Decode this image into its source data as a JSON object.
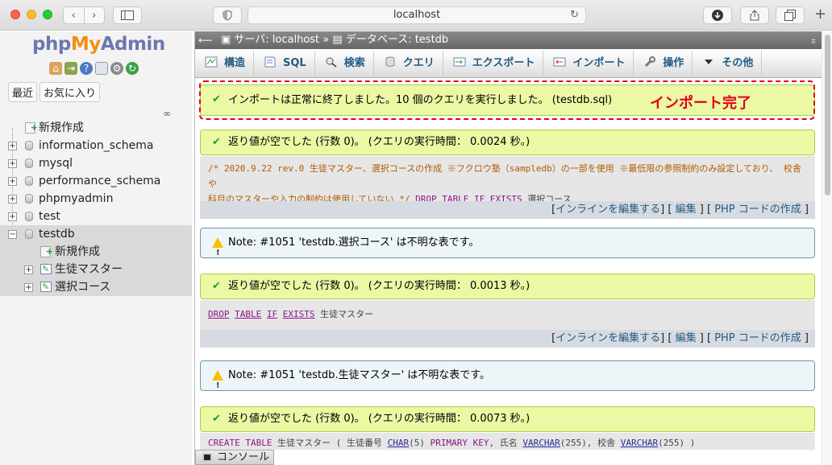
{
  "browser": {
    "url": "localhost"
  },
  "nav": {
    "logo": {
      "php": "php",
      "my": "My",
      "admin": "Admin"
    },
    "tabs": [
      "最近",
      "お気に入り"
    ],
    "tree": [
      {
        "label": "新規作成",
        "kind": "new"
      },
      {
        "label": "information_schema",
        "kind": "db"
      },
      {
        "label": "mysql",
        "kind": "db"
      },
      {
        "label": "performance_schema",
        "kind": "db"
      },
      {
        "label": "phpmyadmin",
        "kind": "db"
      },
      {
        "label": "test",
        "kind": "db"
      },
      {
        "label": "testdb",
        "kind": "db",
        "expanded": true
      },
      {
        "label": "新規作成",
        "kind": "new-sub"
      },
      {
        "label": "生徒マスター",
        "kind": "table"
      },
      {
        "label": "選択コース",
        "kind": "table"
      }
    ]
  },
  "breadcrumb": {
    "server": "サーバ: localhost",
    "sep": "»",
    "database": "データベース: testdb"
  },
  "menu": [
    {
      "label": "構造",
      "icon": "structure-icon"
    },
    {
      "label": "SQL",
      "icon": "sql-icon"
    },
    {
      "label": "検索",
      "icon": "search-icon"
    },
    {
      "label": "クエリ",
      "icon": "query-icon"
    },
    {
      "label": "エクスポート",
      "icon": "export-icon"
    },
    {
      "label": "インポート",
      "icon": "import-icon"
    },
    {
      "label": "操作",
      "icon": "wrench-icon"
    },
    {
      "label": "その他",
      "icon": "chevron-down-icon"
    }
  ],
  "messages": {
    "import_success": "インポートは正常に終了しました。10 個のクエリを実行しました。 (testdb.sql)",
    "annotation": "インポート完了",
    "result1": "返り値が空でした (行数 0)。 (クエリの実行時間： 0.0024 秒。)",
    "sql1_line1": "/* 2020.9.22 rev.0 生徒マスター、選択コースの作成 ※フクロウ塾（sampledb）の一部を使用 ※最低限の参照制約のみ設定しており、 校舎や",
    "sql1_line2_comment": "科目のマスターや入力の制約は使用していない */",
    "sql1_line2_rest": "選択コース",
    "note1": "Note: #1051 'testdb.選択コース' は不明な表です。",
    "result2": "返り値が空でした (行数 0)。 (クエリの実行時間： 0.0013 秒。)",
    "sql2_rest": "生徒マスター",
    "note2": "Note: #1051 'testdb.生徒マスター' は不明な表です。",
    "result3": "返り値が空でした (行数 0)。 (クエリの実行時間： 0.0073 秒。)",
    "sql3_a": "生徒マスター (  生徒番号",
    "sql3_b": "(5)",
    "sql3_c": ", 氏名",
    "sql3_d": "(255), 校舎",
    "sql3_e": "(255) )"
  },
  "sql_keywords": {
    "drop": "DROP",
    "table": "TABLE",
    "if": "IF",
    "exists": "EXISTS",
    "create": "CREATE",
    "char": "CHAR",
    "primary_key": "PRIMARY KEY",
    "varchar": "VARCHAR"
  },
  "links": {
    "edit_inline": "インラインを編集する",
    "edit": "編集",
    "php_code": "PHP コードの作成",
    "open": "[",
    "close": "]"
  },
  "console": "コンソール",
  "colors": {
    "success_bg": "#ebf8a4",
    "note_bg": "#eef5f8",
    "highlight": "#e0001a",
    "link": "#235a81"
  }
}
